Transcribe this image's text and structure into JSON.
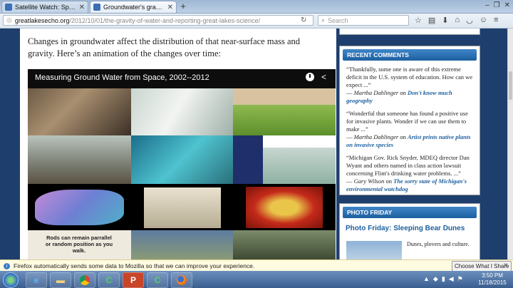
{
  "browser": {
    "tabs": [
      {
        "title": "Satellite Watch: Spring cha..."
      },
      {
        "title": "Groundwater's gravity and ..."
      }
    ],
    "url_domain": "greatlakesecho.org",
    "url_path": "/2012/10/01/the-gravity-of-water-and-reporting-great-lakes-science/",
    "search_placeholder": "Search"
  },
  "article": {
    "intro": "Changes in groundwater affect the distribution of that near-surface mass and gravity. Here’s an animation of the changes over time:",
    "video_title": "Measuring Ground Water from Space, 2002--2012",
    "thumb_caption": "Rods can remain parrallel or random position as you walk."
  },
  "sidebar": {
    "recent_comments_title": "RECENT COMMENTS",
    "comments": [
      {
        "quote": "“Thankfully, some one is aware of this extreme deficit in the U.S. system of education. How can we expect ...”",
        "dash": "— ",
        "author": "Martha Dahlinger",
        "on": " on ",
        "post": "Don't know much geography"
      },
      {
        "quote": "“Wonderful that someone has found a positive use for invasive plants. Wonder if we can use them to make ...”",
        "dash": "— ",
        "author": "Martha Dahlinger",
        "on": " on ",
        "post": "Artist prints native plants on invasive species"
      },
      {
        "quote": "“Michigan Gov. Rick Snyder, MDEQ director Dan Wyant and others named in class action lawsuit concerning Flint's drinking water problems. ...”",
        "dash": "— ",
        "author": "Gary Wilson",
        "on": " on ",
        "post": "The sorry state of Michigan's environmental watchdog"
      }
    ],
    "photo_friday_title": "PHOTO FRIDAY",
    "photo_friday_post": "Photo Friday: Sleeping Bear Dunes",
    "photo_friday_desc": "Dunes, plovers and culture."
  },
  "notification": {
    "text": "Firefox automatically sends some data to Mozilla so that we can improve your experience.",
    "button": "Choose What I Share"
  },
  "taskbar": {
    "time": "3:50 PM",
    "date": "11/18/2015"
  }
}
